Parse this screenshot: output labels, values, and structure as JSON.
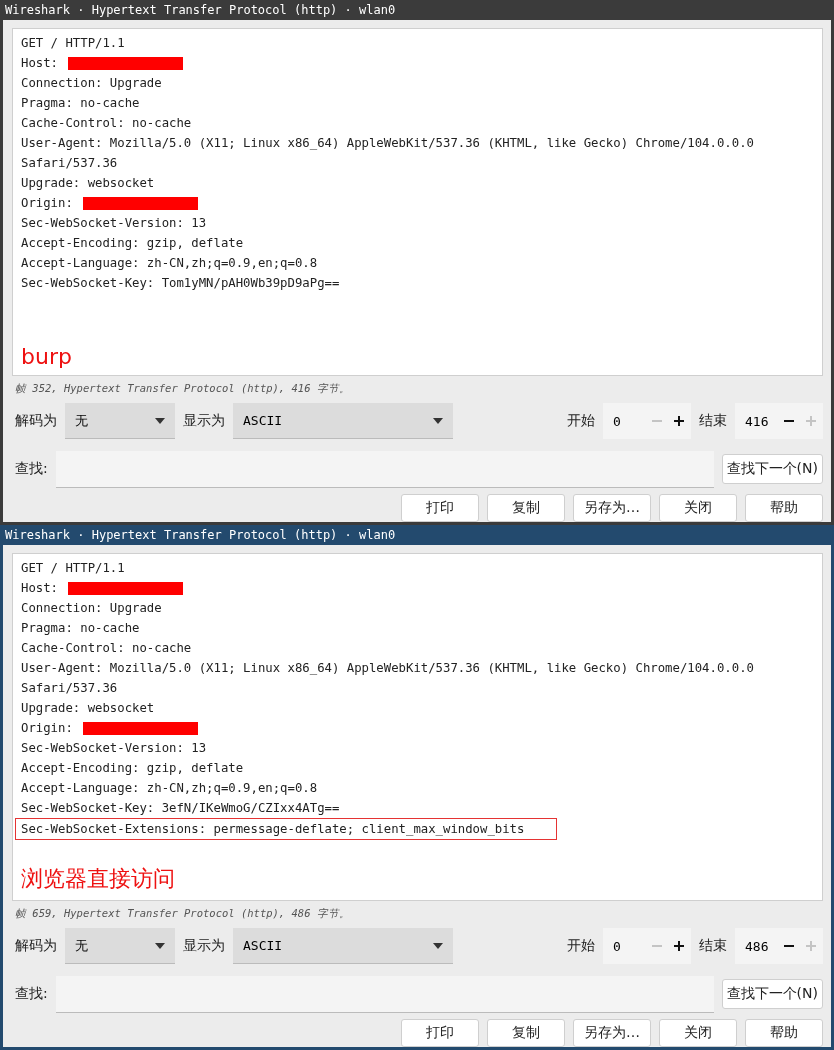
{
  "windows": [
    {
      "title": "Wireshark · Hypertext Transfer Protocol (http) · wlan0",
      "focused": false,
      "lines": [
        {
          "text": "GET / HTTP/1.1",
          "redacted": false,
          "boxed": false
        },
        {
          "text": "Host:",
          "redacted": true,
          "boxed": false
        },
        {
          "text": "Connection: Upgrade",
          "redacted": false,
          "boxed": false
        },
        {
          "text": "Pragma: no-cache",
          "redacted": false,
          "boxed": false
        },
        {
          "text": "Cache-Control: no-cache",
          "redacted": false,
          "boxed": false
        },
        {
          "text": "User-Agent: Mozilla/5.0 (X11; Linux x86_64) AppleWebKit/537.36 (KHTML, like Gecko) Chrome/104.0.0.0 Safari/537.36",
          "redacted": false,
          "boxed": false
        },
        {
          "text": "Upgrade: websocket",
          "redacted": false,
          "boxed": false
        },
        {
          "text": "Origin:",
          "redacted": true,
          "boxed": false
        },
        {
          "text": "Sec-WebSocket-Version: 13",
          "redacted": false,
          "boxed": false
        },
        {
          "text": "Accept-Encoding: gzip, deflate",
          "redacted": false,
          "boxed": false
        },
        {
          "text": "Accept-Language: zh-CN,zh;q=0.9,en;q=0.8",
          "redacted": false,
          "boxed": false
        },
        {
          "text": "Sec-WebSocket-Key: Tom1yMN/pAH0Wb39pD9aPg==",
          "redacted": false,
          "boxed": false
        }
      ],
      "annotation": "burp",
      "status": "帧 352, Hypertext Transfer Protocol (http), 416 字节。",
      "decode_label": "解码为",
      "decode_value": "无",
      "show_label": "显示为",
      "show_value": "ASCII",
      "start_label": "开始",
      "start_value": "0",
      "start_minus_disabled": true,
      "start_plus_disabled": false,
      "end_label": "结束",
      "end_value": "416",
      "end_minus_disabled": false,
      "end_plus_disabled": true,
      "find_label": "查找:",
      "find_next": "查找下一个(N)",
      "buttons": [
        "打印",
        "复制",
        "另存为…",
        "关闭",
        "帮助"
      ]
    },
    {
      "title": "Wireshark · Hypertext Transfer Protocol (http) · wlan0",
      "focused": true,
      "lines": [
        {
          "text": "GET / HTTP/1.1",
          "redacted": false,
          "boxed": false
        },
        {
          "text": "Host:",
          "redacted": true,
          "boxed": false
        },
        {
          "text": "Connection: Upgrade",
          "redacted": false,
          "boxed": false
        },
        {
          "text": "Pragma: no-cache",
          "redacted": false,
          "boxed": false
        },
        {
          "text": "Cache-Control: no-cache",
          "redacted": false,
          "boxed": false
        },
        {
          "text": "User-Agent: Mozilla/5.0 (X11; Linux x86_64) AppleWebKit/537.36 (KHTML, like Gecko) Chrome/104.0.0.0 Safari/537.36",
          "redacted": false,
          "boxed": false
        },
        {
          "text": "Upgrade: websocket",
          "redacted": false,
          "boxed": false
        },
        {
          "text": "Origin:",
          "redacted": true,
          "boxed": false
        },
        {
          "text": "Sec-WebSocket-Version: 13",
          "redacted": false,
          "boxed": false
        },
        {
          "text": "Accept-Encoding: gzip, deflate",
          "redacted": false,
          "boxed": false
        },
        {
          "text": "Accept-Language: zh-CN,zh;q=0.9,en;q=0.8",
          "redacted": false,
          "boxed": false
        },
        {
          "text": "Sec-WebSocket-Key: 3efN/IKeWmoG/CZIxx4ATg==",
          "redacted": false,
          "boxed": false
        },
        {
          "text": "Sec-WebSocket-Extensions: permessage-deflate; client_max_window_bits",
          "redacted": false,
          "boxed": true
        }
      ],
      "annotation": "浏览器直接访问",
      "status": "帧 659, Hypertext Transfer Protocol (http), 486 字节。",
      "decode_label": "解码为",
      "decode_value": "无",
      "show_label": "显示为",
      "show_value": "ASCII",
      "start_label": "开始",
      "start_value": "0",
      "start_minus_disabled": true,
      "start_plus_disabled": false,
      "end_label": "结束",
      "end_value": "486",
      "end_minus_disabled": false,
      "end_plus_disabled": true,
      "find_label": "查找:",
      "find_next": "查找下一个(N)",
      "buttons": [
        "打印",
        "复制",
        "另存为…",
        "关闭",
        "帮助"
      ]
    }
  ]
}
